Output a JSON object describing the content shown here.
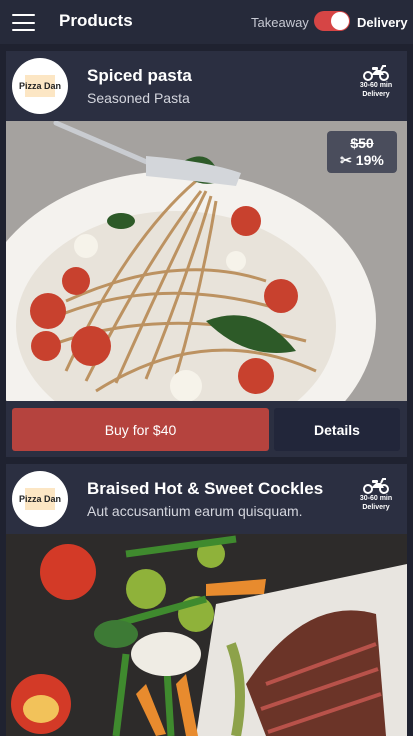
{
  "topbar": {
    "title": "Products",
    "mode_takeaway": "Takeaway",
    "mode_delivery": "Delivery",
    "delivery_selected": true
  },
  "colors": {
    "accent_red": "#b5433e",
    "toggle_on": "#d64545",
    "card_bg": "#2b2f41",
    "page_bg": "#1f2230"
  },
  "products": [
    {
      "restaurant_logo_text": "Pizza Dan",
      "name": "Spiced pasta",
      "description": "Seasoned Pasta",
      "delivery_time": "30-60 min",
      "delivery_label": "Delivery",
      "old_price": "$50",
      "discount": "19%",
      "buy_label": "Buy for $40",
      "details_label": "Details"
    },
    {
      "restaurant_logo_text": "Pizza Dan",
      "name": "Braised Hot & Sweet Cockles",
      "description": "Aut accusantium earum quisquam.",
      "delivery_time": "30-60 min",
      "delivery_label": "Delivery"
    }
  ]
}
